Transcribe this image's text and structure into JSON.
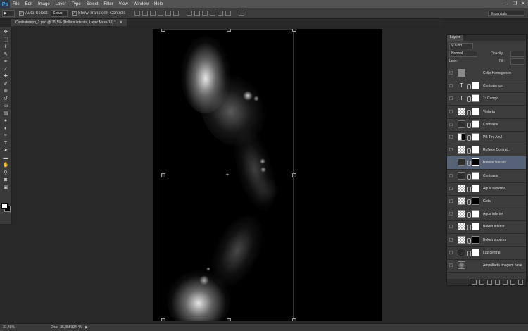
{
  "app": {
    "logo": "Ps"
  },
  "menu": [
    "File",
    "Edit",
    "Image",
    "Layer",
    "Type",
    "Select",
    "Filter",
    "View",
    "Window",
    "Help"
  ],
  "window_controls": [
    "–",
    "❐",
    "✕"
  ],
  "options": {
    "tool_glyph": "▶",
    "auto_select_label": "Auto-Select:",
    "auto_select_value": "Group",
    "show_transform_label": "Show Transform Controls"
  },
  "workspace": "Essentials",
  "document": {
    "tab_title": "Contratempo_2.psd @ 31,5% (Brilhos laterais, Layer Mask/16) *"
  },
  "tools": [
    {
      "name": "move-tool",
      "icon": "✥"
    },
    {
      "name": "marquee-tool",
      "icon": "⬚"
    },
    {
      "name": "lasso-tool",
      "icon": "ℓ"
    },
    {
      "name": "quick-select-tool",
      "icon": "✎"
    },
    {
      "name": "crop-tool",
      "icon": "⌗"
    },
    {
      "name": "eyedropper-tool",
      "icon": "⁄"
    },
    {
      "name": "healing-tool",
      "icon": "✚"
    },
    {
      "name": "brush-tool",
      "icon": "✐"
    },
    {
      "name": "clone-tool",
      "icon": "⊕"
    },
    {
      "name": "history-brush-tool",
      "icon": "↺"
    },
    {
      "name": "eraser-tool",
      "icon": "▭"
    },
    {
      "name": "gradient-tool",
      "icon": "▤"
    },
    {
      "name": "blur-tool",
      "icon": "●"
    },
    {
      "name": "dodge-tool",
      "icon": "◐"
    },
    {
      "name": "pen-tool",
      "icon": "✒"
    },
    {
      "name": "type-tool",
      "icon": "T"
    },
    {
      "name": "path-select-tool",
      "icon": "➤"
    },
    {
      "name": "shape-tool",
      "icon": "▬"
    },
    {
      "name": "hand-tool",
      "icon": "✋"
    },
    {
      "name": "zoom-tool",
      "icon": "⚲"
    },
    {
      "name": "quick-mask-tool",
      "icon": "◙"
    },
    {
      "name": "screen-mode-tool",
      "icon": "▣"
    }
  ],
  "status": {
    "zoom": "31,46%",
    "doc_label": "Doc:",
    "doc_size": "36,3M/304,4M"
  },
  "layers_panel": {
    "tab": "Layers",
    "filter": "Kind",
    "blend_mode": "Normal",
    "opacity_label": "Opacity:",
    "lock_label": "Lock:",
    "fill_label": "Fill:",
    "layers": [
      {
        "name": "Grão Homogeneo",
        "thumb": "gray",
        "mask": false,
        "selected": false
      },
      {
        "name": "Contratempo",
        "thumb": "text",
        "mask": true,
        "selected": false
      },
      {
        "name": "1º Campo",
        "thumb": "text",
        "mask": true,
        "selected": false
      },
      {
        "name": "Vinheta",
        "thumb": "checker",
        "mask": true,
        "selected": false
      },
      {
        "name": "Contraste",
        "thumb": "adj",
        "mask": true,
        "selected": false
      },
      {
        "name": "PB Tint Azul",
        "thumb": "adj2",
        "mask": true,
        "selected": false
      },
      {
        "name": "Reflexo Contrat...",
        "thumb": "checker",
        "mask": true,
        "selected": false
      },
      {
        "name": "Brilhos laterais",
        "thumb": "adj",
        "mask": true,
        "selected": true
      },
      {
        "name": "Contraste",
        "thumb": "adj",
        "mask": true,
        "selected": false
      },
      {
        "name": "Água superior",
        "thumb": "checker",
        "mask": true,
        "selected": false
      },
      {
        "name": "Gota",
        "thumb": "checker",
        "mask": true,
        "selected": false
      },
      {
        "name": "Água inferior",
        "thumb": "checker",
        "mask": true,
        "selected": false
      },
      {
        "name": "Bokeh inferior",
        "thumb": "checker",
        "mask": true,
        "selected": false
      },
      {
        "name": "Bokeh superior",
        "thumb": "checker",
        "mask": true,
        "selected": false
      },
      {
        "name": "Luz central",
        "thumb": "adj",
        "mask": true,
        "selected": false
      },
      {
        "name": "Ampulheta Imagem base",
        "thumb": "photo",
        "mask": false,
        "selected": false
      }
    ]
  }
}
